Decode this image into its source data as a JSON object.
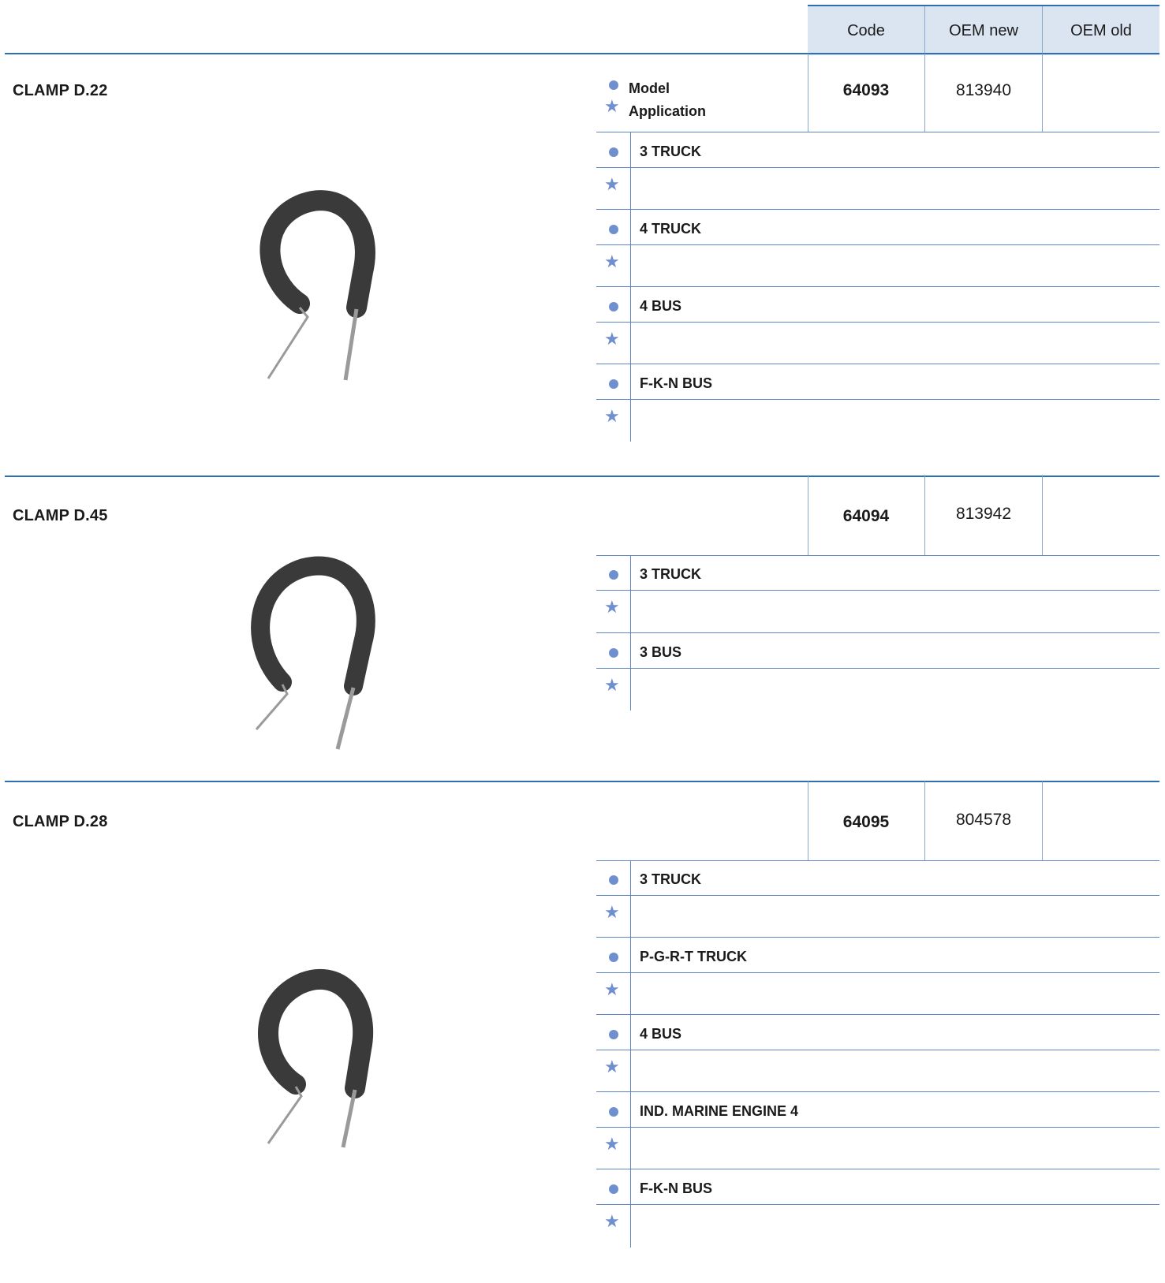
{
  "header": {
    "code_label": "Code",
    "oem_new_label": "OEM new",
    "oem_old_label": "OEM old"
  },
  "legend": {
    "model_label": "Model",
    "application_label": "Application"
  },
  "products": [
    {
      "title": "CLAMP D.22",
      "code": "64093",
      "oem_new": "813940",
      "oem_old": "",
      "models": [
        "3 TRUCK",
        "4 TRUCK",
        "4 BUS",
        "F-K-N BUS"
      ]
    },
    {
      "title": "CLAMP D.45",
      "code": "64094",
      "oem_new": "813942",
      "oem_old": "",
      "models": [
        "3 TRUCK",
        "3 BUS"
      ]
    },
    {
      "title": "CLAMP D.28",
      "code": "64095",
      "oem_new": "804578",
      "oem_old": "",
      "models": [
        "3 TRUCK",
        "P-G-R-T TRUCK",
        "4 BUS",
        "IND. MARINE ENGINE 4",
        "F-K-N BUS"
      ]
    }
  ],
  "colors": {
    "accent": "#2e6fb0",
    "header_bg": "#dbe4f1",
    "bullet": "#6f8fcf"
  },
  "icons": {
    "model_bullet": "filled-circle",
    "application_bullet": "star"
  }
}
